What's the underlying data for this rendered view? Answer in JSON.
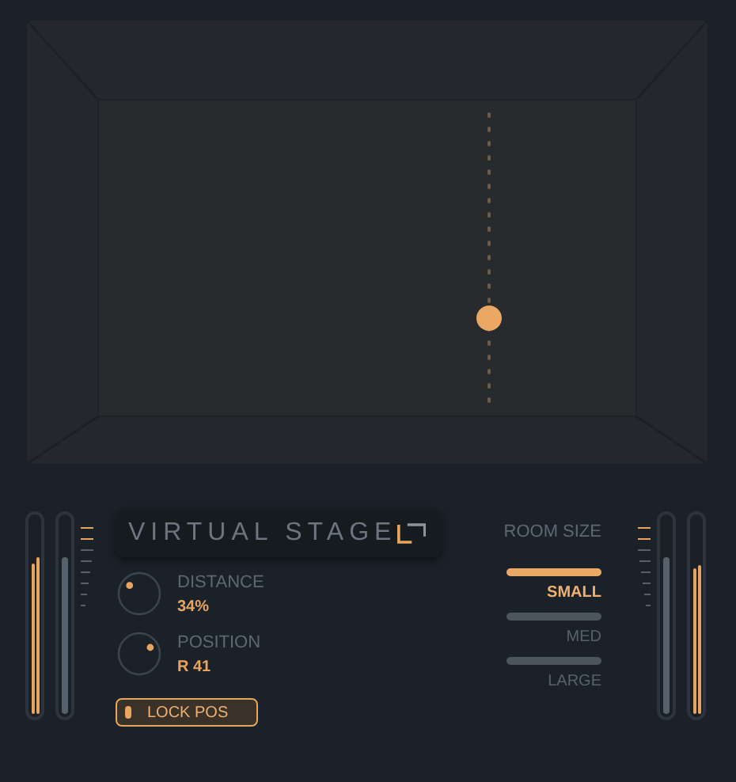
{
  "title": "VIRTUAL STAGE",
  "meters_left": [
    {
      "kind": "stereo",
      "channels": [
        {
          "level": 0.77
        },
        {
          "level": 0.8
        }
      ]
    },
    {
      "kind": "mono",
      "level": 0.8
    }
  ],
  "ticks_left": [
    {
      "lit": true
    },
    {
      "lit": true
    },
    {
      "lit": false
    },
    {
      "lit": false
    },
    {
      "lit": false
    },
    {
      "lit": false
    },
    {
      "lit": false
    },
    {
      "lit": false
    }
  ],
  "knobs": [
    {
      "label": "DISTANCE",
      "value": "34%"
    },
    {
      "label": "POSITION",
      "value": "R 41"
    }
  ],
  "lock": {
    "label": "LOCK POS",
    "on": true
  },
  "room_size": {
    "label": "ROOM SIZE",
    "options": [
      {
        "label": "SMALL",
        "selected": true
      },
      {
        "label": "MED",
        "selected": false
      },
      {
        "label": "LARGE",
        "selected": false
      }
    ]
  },
  "ticks_right": [
    {
      "lit": true
    },
    {
      "lit": true
    },
    {
      "lit": false
    },
    {
      "lit": false
    },
    {
      "lit": false
    },
    {
      "lit": false
    },
    {
      "lit": false
    },
    {
      "lit": false
    }
  ],
  "meters_right": [
    {
      "kind": "mono",
      "level": 0.8
    },
    {
      "kind": "stereo",
      "channels": [
        {
          "level": 0.74
        },
        {
          "level": 0.76
        }
      ]
    }
  ]
}
